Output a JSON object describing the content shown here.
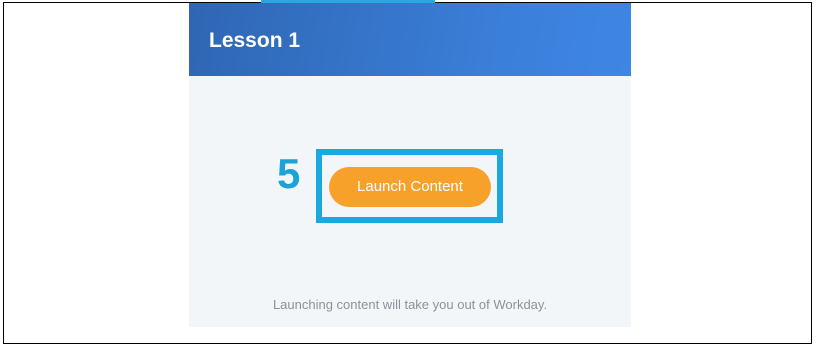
{
  "lesson": {
    "title": "Lesson 1",
    "launch_label": "Launch Content",
    "footer_note": "Launching content will take you out of Workday."
  },
  "annotation": {
    "step_number": "5"
  },
  "colors": {
    "header_start": "#2f66b3",
    "header_end": "#3f86e4",
    "button": "#f7a12a",
    "highlight": "#1aa8e0",
    "card_background": "#f3f6f9"
  }
}
